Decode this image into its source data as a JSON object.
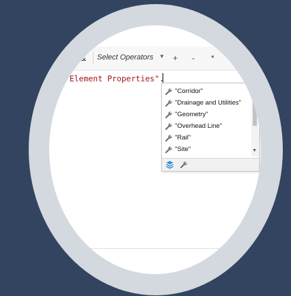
{
  "toolbar": {
    "amp_label": "&",
    "select_operators_label": "Select Operators",
    "select_caret": "▼",
    "operators": [
      "+",
      "-",
      "*",
      "/"
    ]
  },
  "editor": {
    "line_text": "vil Element Properties\"",
    "line_dot": "."
  },
  "popup": {
    "items": [
      {
        "label": "\"Corridor\"",
        "icon": "wrench-icon"
      },
      {
        "label": "\"Drainage and Utilities\"",
        "icon": "wrench-icon"
      },
      {
        "label": "\"Geometry\"",
        "icon": "wrench-icon"
      },
      {
        "label": "\"Overhead Line\"",
        "icon": "wrench-icon"
      },
      {
        "label": "\"Rail\"",
        "icon": "wrench-icon"
      },
      {
        "label": "\"Site\"",
        "icon": "wrench-icon"
      }
    ],
    "footer_icons": [
      "layers-icon",
      "wrench-icon"
    ]
  },
  "colors": {
    "background": "#32445f",
    "ring": "#d3d9df",
    "string_literal": "#a31515",
    "layers_icon": "#2e8bd8"
  }
}
